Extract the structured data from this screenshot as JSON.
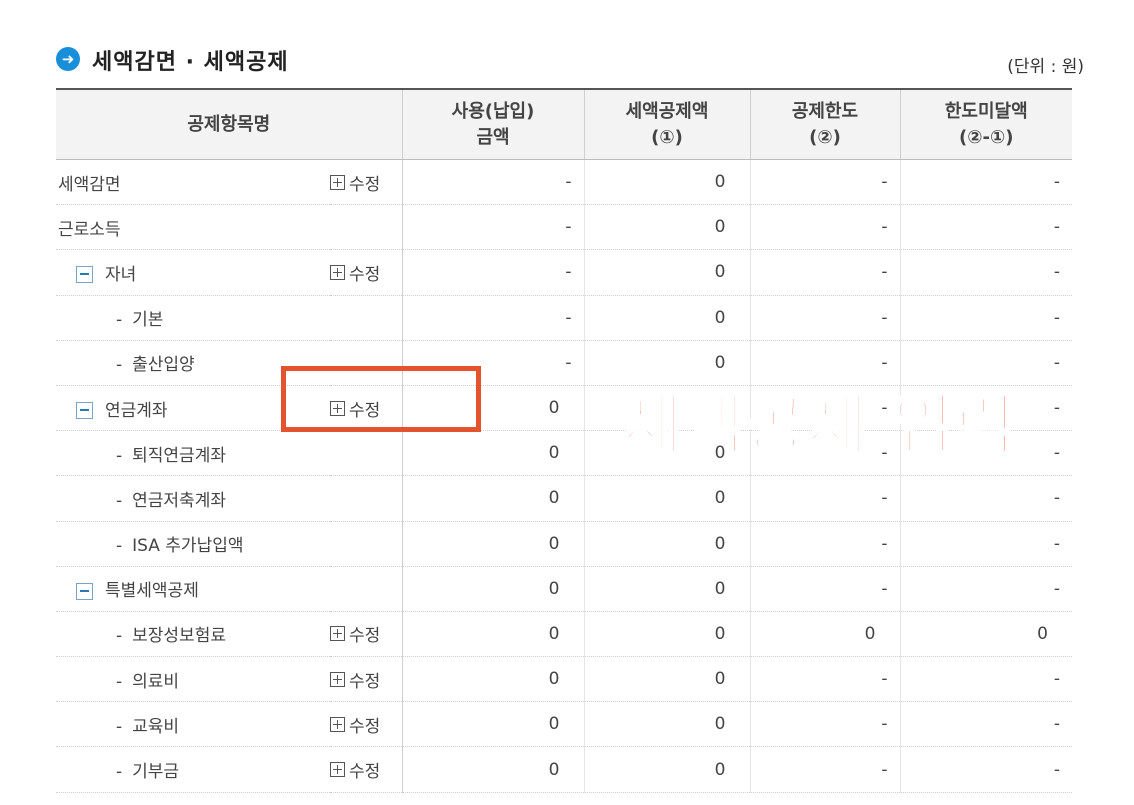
{
  "header": {
    "title": "세액감면 · 세액공제",
    "unit": "(단위 : 원)"
  },
  "columns": [
    {
      "line1": "공제항목명",
      "line2": ""
    },
    {
      "line1": "사용(납입)",
      "line2": "금액"
    },
    {
      "line1": "세액공제액",
      "line2": "(①)"
    },
    {
      "line1": "공제한도",
      "line2": "(②)"
    },
    {
      "line1": "한도미달액",
      "line2": "(②-①)"
    }
  ],
  "rows": [
    {
      "label": "세액감면",
      "level": 0,
      "toggle": false,
      "edit": "수정",
      "c1": "-",
      "c2": "0",
      "c3": "-",
      "c4": "-"
    },
    {
      "label": "근로소득",
      "level": 0,
      "toggle": false,
      "edit": "",
      "c1": "-",
      "c2": "0",
      "c3": "-",
      "c4": "-"
    },
    {
      "label": "자녀",
      "level": 0,
      "toggle": true,
      "edit": "수정",
      "c1": "-",
      "c2": "0",
      "c3": "-",
      "c4": "-"
    },
    {
      "label": "기본",
      "level": 1,
      "toggle": false,
      "edit": "",
      "c1": "-",
      "c2": "0",
      "c3": "-",
      "c4": "-"
    },
    {
      "label": "출산입양",
      "level": 1,
      "toggle": false,
      "edit": "",
      "c1": "-",
      "c2": "0",
      "c3": "-",
      "c4": "-"
    },
    {
      "label": "연금계좌",
      "level": 0,
      "toggle": true,
      "edit": "수정",
      "c1": "0",
      "c2": "0",
      "c3": "-",
      "c4": "-"
    },
    {
      "label": "퇴직연금계좌",
      "level": 1,
      "toggle": false,
      "edit": "",
      "c1": "0",
      "c2": "0",
      "c3": "-",
      "c4": "-"
    },
    {
      "label": "연금저축계좌",
      "level": 1,
      "toggle": false,
      "edit": "",
      "c1": "0",
      "c2": "0",
      "c3": "-",
      "c4": "-"
    },
    {
      "label": "ISA 추가납입액",
      "level": 1,
      "toggle": false,
      "edit": "",
      "c1": "0",
      "c2": "0",
      "c3": "-",
      "c4": "-"
    },
    {
      "label": "특별세액공제",
      "level": 0,
      "toggle": true,
      "edit": "",
      "c1": "0",
      "c2": "0",
      "c3": "-",
      "c4": "-"
    },
    {
      "label": "보장성보험료",
      "level": 1,
      "toggle": false,
      "edit": "수정",
      "c1": "0",
      "c2": "0",
      "c3": "0",
      "c4": "0"
    },
    {
      "label": "의료비",
      "level": 1,
      "toggle": false,
      "edit": "수정",
      "c1": "0",
      "c2": "0",
      "c3": "-",
      "c4": "-"
    },
    {
      "label": "교육비",
      "level": 1,
      "toggle": false,
      "edit": "수정",
      "c1": "0",
      "c2": "0",
      "c3": "-",
      "c4": "-"
    },
    {
      "label": "기부금",
      "level": 1,
      "toggle": false,
      "edit": "수정",
      "c1": "0",
      "c2": "0",
      "c3": "-",
      "c4": "-"
    }
  ],
  "overlay": {
    "caption": "세액공제 입력",
    "highlight_color": "#e2532e"
  },
  "colors": {
    "accent": "#1a8fd9",
    "overlay_text": "#e8533a"
  }
}
